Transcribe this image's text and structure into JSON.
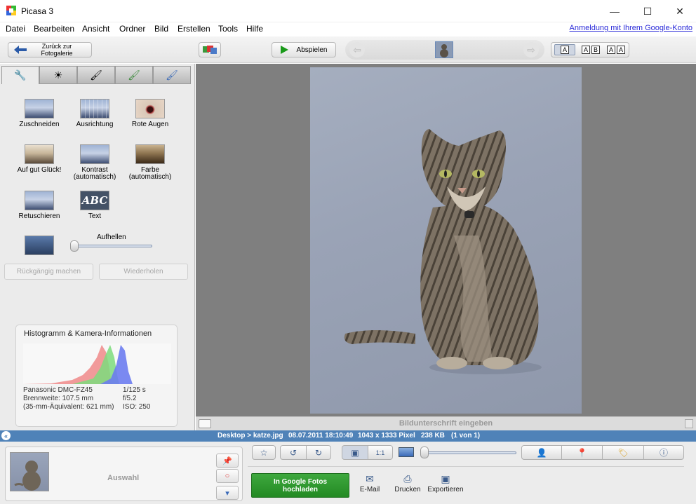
{
  "window": {
    "title": "Picasa 3",
    "minimize": "—",
    "maximize": "☐",
    "close": "✕"
  },
  "menu": {
    "items": [
      "Datei",
      "Bearbeiten",
      "Ansicht",
      "Ordner",
      "Bild",
      "Erstellen",
      "Tools",
      "Hilfe"
    ],
    "google_login": "Anmeldung mit Ihrem Google-Konto"
  },
  "toolbar": {
    "back_line1": "Zurück zur",
    "back_line2": "Fotogalerie",
    "play_label": "Abspielen",
    "prev_arrow": "⇦",
    "next_arrow": "⇨",
    "view_single": "A",
    "view_two_a": "A",
    "view_two_b": "B",
    "view_compare_a": "A",
    "view_compare_b": "A"
  },
  "tabs": {
    "tab1_icon": "wrench-icon",
    "tab2_icon": "sun-icon",
    "tab3_icon": "brush-icon",
    "tab4_icon": "green-brush-icon",
    "tab5_icon": "blue-brush-icon",
    "glyph1": "🔧",
    "glyph2": "☀",
    "glyph3": "🖌",
    "glyph4": "🖌",
    "glyph5": "🖌"
  },
  "tools": {
    "crop": "Zuschneiden",
    "straighten": "Ausrichtung",
    "redeye": "Rote Augen",
    "lucky": "Auf gut Glück!",
    "contrast_line1": "Kontrast",
    "contrast_line2": "(automatisch)",
    "color_line1": "Farbe",
    "color_line2": "(automatisch)",
    "retouch": "Retuschieren",
    "text": "Text",
    "text_thumb": "ABC",
    "fill_light_label": "Aufhellen",
    "fill_light_value": 0.0,
    "undo": "Rückgängig machen",
    "redo": "Wiederholen"
  },
  "histogram": {
    "title": "Histogramm & Kamera-Informationen",
    "camera": "Panasonic DMC-FZ45",
    "focal": "Brennweite: 107.5 mm",
    "equiv": "(35-mm-Äquivalent: 621 mm)",
    "shutter": "1/125 s",
    "aperture": "f/5.2",
    "iso": "ISO: 250",
    "colors": {
      "red": "#f08a8a",
      "green": "#7ddc7d",
      "blue": "#6c7cf0"
    }
  },
  "caption": {
    "placeholder": "Bildunterschrift eingeben"
  },
  "status": {
    "path": "Desktop > katze.jpg",
    "date": "08.07.2011 18:10:49",
    "dimensions": "1043 x 1333 Pixel",
    "size": "238 KB",
    "position": "(1 von 1)",
    "collapse": "«"
  },
  "tray": {
    "selection_label": "Auswahl",
    "upload_line1": "In Google Fotos",
    "upload_line2": "hochladen",
    "email": "E-Mail",
    "print": "Drucken",
    "export": "Exportieren",
    "actual_size": "1:1",
    "zoom_value": 0.0
  },
  "colors": {
    "accent_blue": "#4f82b8",
    "upload_green": "#2e9a2e",
    "link": "#2a2ad8"
  }
}
